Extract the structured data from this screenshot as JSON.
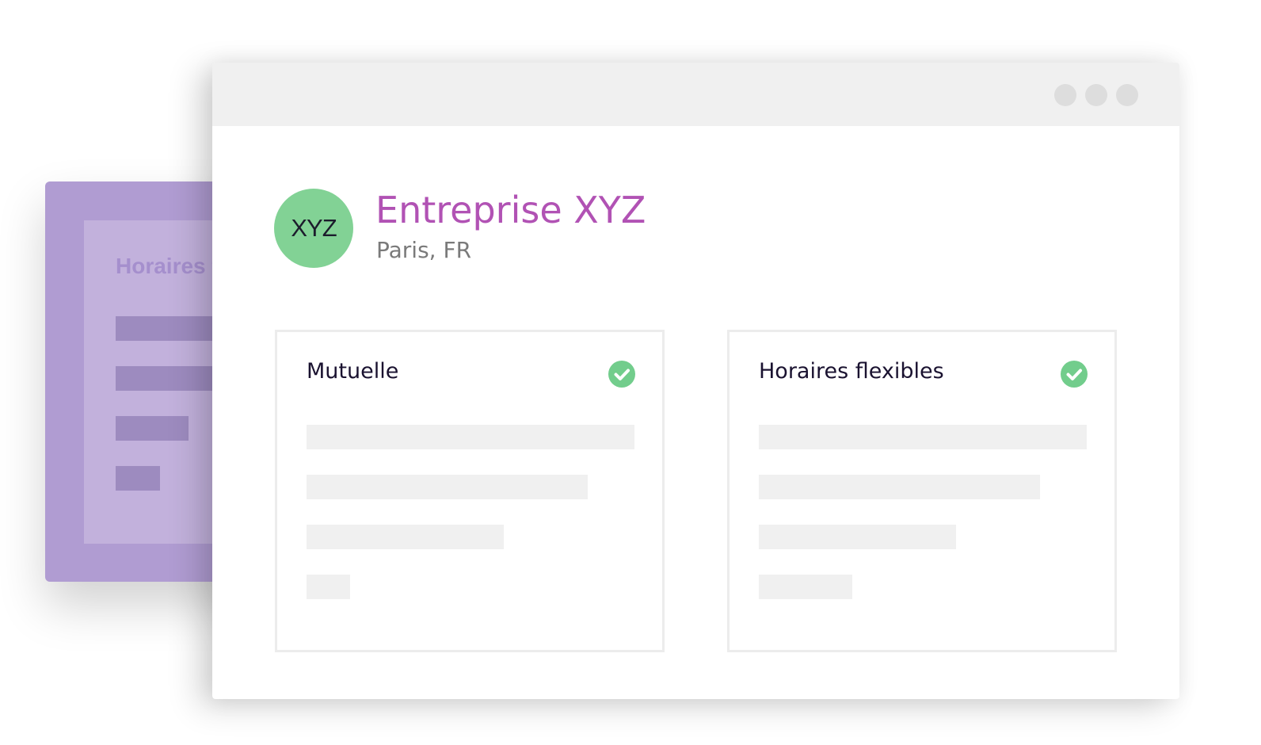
{
  "background_card": {
    "title": "Horaires flexibles",
    "line_widths_pct": [
      100,
      86,
      40,
      24
    ]
  },
  "window": {
    "controls": [
      "window-dot",
      "window-dot",
      "window-dot"
    ]
  },
  "company": {
    "logo_text": "XYZ",
    "name": "Entreprise XYZ",
    "location": "Paris, FR"
  },
  "benefits": [
    {
      "title": "Mutuelle",
      "status_icon": "check-circle-icon",
      "placeholder_line_widths_pct": [
        100,
        86,
        60,
        13
      ]
    },
    {
      "title": "Horaires flexibles",
      "status_icon": "check-circle-icon",
      "placeholder_line_widths_pct": [
        100,
        86,
        60,
        29
      ]
    }
  ],
  "colors": {
    "brand_purple": "#b152b4",
    "logo_green": "#82d295",
    "check_green": "#72cd8c",
    "back_card_purple": "#b09cd2"
  }
}
